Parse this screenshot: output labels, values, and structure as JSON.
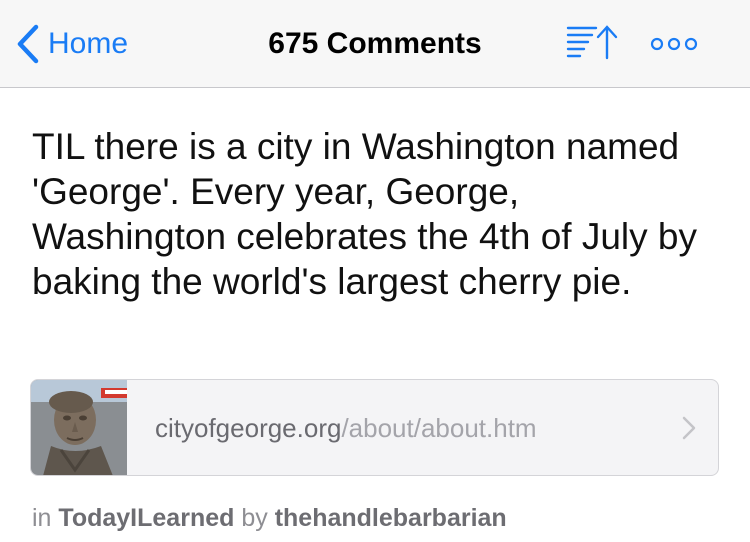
{
  "navbar": {
    "back_label": "Home",
    "title": "675 Comments",
    "sort_icon": "sort-up-icon",
    "more_icon": "ellipsis-icon",
    "accent_color": "#1a7cf5"
  },
  "post": {
    "title": "TIL there is a city in Washington named 'George'. Every year, George, Washington celebrates the 4th of July by baking the world's largest cherry pie.",
    "link": {
      "domain": "cityofgeorge.org",
      "path": "/about/about.htm",
      "thumbnail_icon": "george-washington-bust-thumbnail"
    },
    "meta": {
      "prefix": "in",
      "subreddit": "TodayILearned",
      "by": "by",
      "author": "thehandlebarbarian"
    }
  }
}
